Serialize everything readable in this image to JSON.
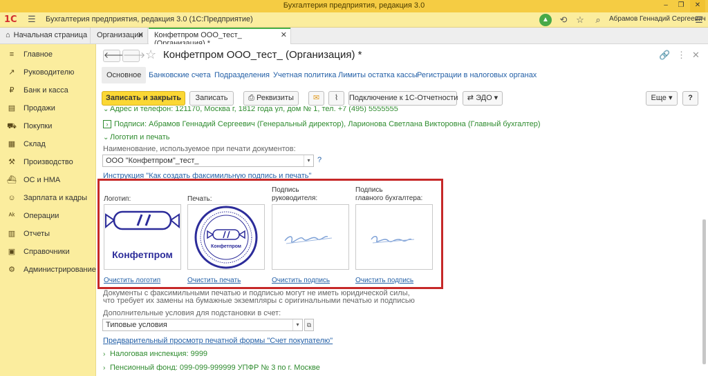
{
  "window": {
    "title": "Бухгалтерия предприятия, редакция 3.0",
    "controls": [
      "–",
      "❐",
      "✕"
    ]
  },
  "appbar": {
    "logo": "1С",
    "title": "Бухгалтерия предприятия, редакция 3.0  (1С:Предприятие)",
    "user": "Абрамов Геннадий Сергеевич"
  },
  "tabs": {
    "home": "Начальная страница",
    "items": [
      {
        "label": "Организации"
      },
      {
        "label": "Конфетпром ООО_тест_ (Организация) *"
      }
    ]
  },
  "sidebar": {
    "items": [
      {
        "label": "Главное",
        "icon": "≡"
      },
      {
        "label": "Руководителю",
        "icon": "↗"
      },
      {
        "label": "Банк и касса",
        "icon": "₽"
      },
      {
        "label": "Продажи",
        "icon": "▤"
      },
      {
        "label": "Покупки",
        "icon": "⛟"
      },
      {
        "label": "Склад",
        "icon": "▦"
      },
      {
        "label": "Производство",
        "icon": "⚒"
      },
      {
        "label": "ОС и НМА",
        "icon": "⛴"
      },
      {
        "label": "Зарплата и кадры",
        "icon": "☺"
      },
      {
        "label": "Операции",
        "icon": "ᴬᵏ"
      },
      {
        "label": "Отчеты",
        "icon": "▥"
      },
      {
        "label": "Справочники",
        "icon": "▣"
      },
      {
        "label": "Администрирование",
        "icon": "⚙"
      }
    ]
  },
  "form": {
    "title": "Конфетпром ООО_тест_ (Организация) *",
    "sections": [
      "Основное",
      "Банковские счета",
      "Подразделения",
      "Учетная политика",
      "Лимиты остатка кассы",
      "Регистрации в налоговых органах"
    ],
    "toolbar": {
      "save_close": "Записать и закрыть",
      "save": "Записать",
      "requisites": "Реквизиты",
      "connect": "Подключение к 1С-Отчетности",
      "edo": "ЭДО",
      "more": "Еще",
      "help": "?"
    },
    "address_row": "Адрес и телефон: 121170, Москва г, 1812 года ул, дом № 1, тел. +7 (495) 5555555",
    "signatures_row": "Подписи: Абрамов Геннадий Сергеевич (Генеральный директор), Ларионова Светлана Викторовна (Главный бухгалтер)",
    "logo_section": "Логотип и печать",
    "print_name_label": "Наименование, используемое при печати документов:",
    "print_name_value": "ООО \"Конфетпром\"_тест_",
    "q_mark": "?",
    "instruction_link": "Инструкция \"Как создать факсимильную подпись и печать\"",
    "images": {
      "logo_label": "Логотип:",
      "seal_label": "Печать:",
      "director_label_1": "Подпись",
      "director_label_2": "руководителя:",
      "accountant_label_1": "Подпись",
      "accountant_label_2": "главного бухгалтера:",
      "logo_text": "Конфетпром",
      "seal_text": "Конфетпром",
      "clear_logo": "Очистить логотип",
      "clear_seal": "Очистить печать",
      "clear_sign1": "Очистить подпись",
      "clear_sign2": "Очистить подпись"
    },
    "disclaimer_1": "Документы с факсимильными печатью и подписью могут не иметь юридической силы,",
    "disclaimer_2": "что требует их замены на бумажные экземпляры с оригинальными печатью и подписью",
    "extra_label": "Дополнительные условия для подстановки в счет:",
    "extra_value": "Типовые условия",
    "preview_link": "Предварительный просмотр печатной формы \"Счет покупателю\"",
    "tax_row": "Налоговая инспекция: 9999",
    "pension_row": "Пенсионный фонд: 099-099-999999 УПФР № 3 по г. Москве"
  }
}
